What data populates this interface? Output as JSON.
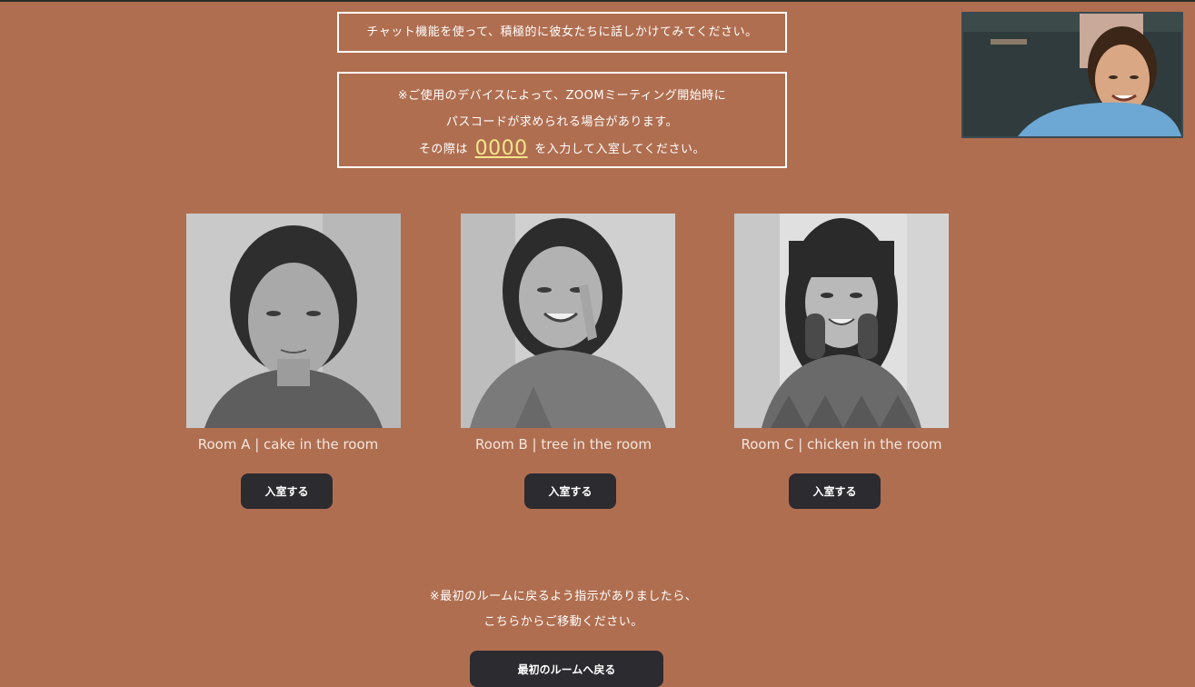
{
  "notice": {
    "chat_text": "チャット機能を使って、積極的に彼女たちに話しかけてみてください。",
    "passcode_line1": "※ご使用のデバイスによって、ZOOMミーティング開始時に",
    "passcode_line2": "パスコードが求められる場合があります。",
    "passcode_line3_pre": "その際は",
    "passcode_code": "0000",
    "passcode_line3_post": "を入力して入室してください。"
  },
  "rooms": [
    {
      "title": "Room A | cake in the room",
      "button": "入室する"
    },
    {
      "title": "Room B | tree in the room",
      "button": "入室する"
    },
    {
      "title": "Room C | chicken in the room",
      "button": "入室する"
    }
  ],
  "footer": {
    "note_line1": "※最初のルームに戻るよう指示がありましたら、",
    "note_line2": "こちらからご移動ください。",
    "back_button": "最初のルームへ戻る"
  },
  "colors": {
    "background": "#b06e50",
    "button": "#2b2b30",
    "code_highlight": "#f4e58a"
  }
}
